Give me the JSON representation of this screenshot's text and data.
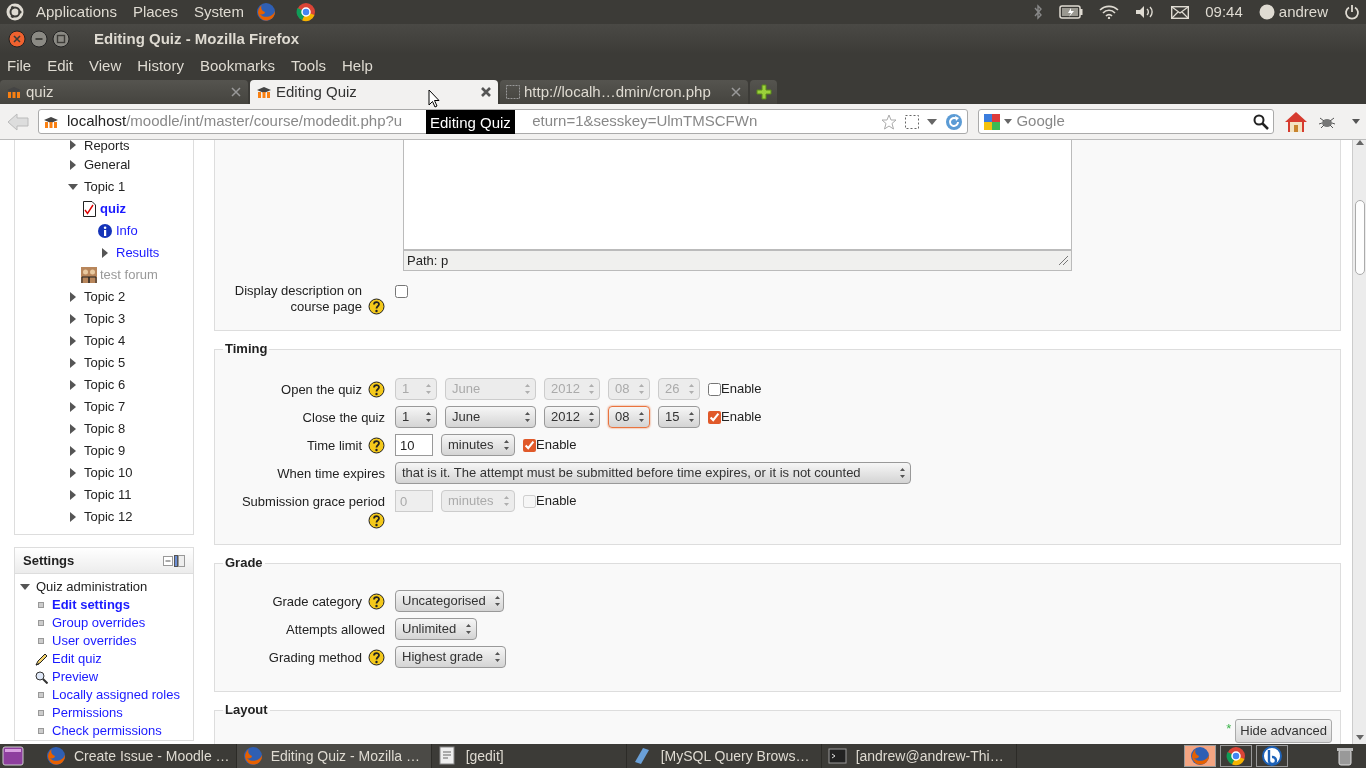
{
  "top_panel": {
    "menus": [
      "Applications",
      "Places",
      "System"
    ],
    "clock": "09:44",
    "user": "andrew"
  },
  "window": {
    "title": "Editing Quiz - Mozilla Firefox"
  },
  "menu_bar": [
    "File",
    "Edit",
    "View",
    "History",
    "Bookmarks",
    "Tools",
    "Help"
  ],
  "tabs": [
    {
      "label": "quiz",
      "kind": "site",
      "selected": false
    },
    {
      "label": "Editing Quiz",
      "kind": "site",
      "selected": true
    },
    {
      "label": "http://localh…dmin/cron.php",
      "kind": "blank",
      "selected": false
    }
  ],
  "address_bar": {
    "host": "localhost",
    "path_start": "/moodle/int/master/course/modedit.php?u",
    "path_end": "eturn=1&sesskey=UlmTMSCFWn"
  },
  "tooltip": "Editing Quiz",
  "search": {
    "placeholder": "Google"
  },
  "navigation": [
    {
      "label": "Reports",
      "kind": "section",
      "expanded": false,
      "selected": false
    },
    {
      "label": "General",
      "kind": "section",
      "expanded": false,
      "selected": false
    },
    {
      "label": "Topic 1",
      "kind": "section",
      "expanded": true,
      "selected": false,
      "children": [
        {
          "label": "quiz",
          "kind": "quiz",
          "selected": true,
          "dimmed": false,
          "children": [
            {
              "label": "Info",
              "kind": "info",
              "selected": false
            },
            {
              "label": "Results",
              "kind": "branch",
              "expanded": false,
              "selected": false
            }
          ]
        },
        {
          "label": "test forum",
          "kind": "forum",
          "selected": false,
          "dimmed": true
        }
      ]
    },
    {
      "label": "Topic 2",
      "kind": "section",
      "expanded": false,
      "selected": false
    },
    {
      "label": "Topic 3",
      "kind": "section",
      "expanded": false,
      "selected": false
    },
    {
      "label": "Topic 4",
      "kind": "section",
      "expanded": false,
      "selected": false
    },
    {
      "label": "Topic 5",
      "kind": "section",
      "expanded": false,
      "selected": false
    },
    {
      "label": "Topic 6",
      "kind": "section",
      "expanded": false,
      "selected": false
    },
    {
      "label": "Topic 7",
      "kind": "section",
      "expanded": false,
      "selected": false
    },
    {
      "label": "Topic 8",
      "kind": "section",
      "expanded": false,
      "selected": false
    },
    {
      "label": "Topic 9",
      "kind": "section",
      "expanded": false,
      "selected": false
    },
    {
      "label": "Topic 10",
      "kind": "section",
      "expanded": false,
      "selected": false
    },
    {
      "label": "Topic 11",
      "kind": "section",
      "expanded": false,
      "selected": false
    },
    {
      "label": "Topic 12",
      "kind": "section",
      "expanded": false,
      "selected": false
    }
  ],
  "settings": {
    "title": "Settings",
    "items": [
      {
        "label": "Quiz administration",
        "kind": "section",
        "expanded": true,
        "selected": false,
        "children": [
          {
            "label": "Edit settings",
            "kind": "leaf",
            "selected": true
          },
          {
            "label": "Group overrides",
            "kind": "leaf",
            "selected": false
          },
          {
            "label": "User overrides",
            "kind": "leaf",
            "selected": false
          },
          {
            "label": "Edit quiz",
            "kind": "edit",
            "selected": false
          },
          {
            "label": "Preview",
            "kind": "preview",
            "selected": false
          },
          {
            "label": "Locally assigned roles",
            "kind": "leaf",
            "selected": false
          },
          {
            "label": "Permissions",
            "kind": "leaf",
            "selected": false
          },
          {
            "label": "Check permissions",
            "kind": "leaf",
            "selected": false
          }
        ]
      }
    ]
  },
  "description": {
    "path": "Path: p",
    "label": "Display description on course page",
    "help": true,
    "checked": false
  },
  "sections": [
    {
      "legend": "Timing",
      "rows": [
        {
          "label": "Open the quiz",
          "help": true,
          "controls": [
            {
              "kind": "select",
              "value": "1",
              "disabled": true,
              "focused": false
            },
            {
              "kind": "select",
              "value": "June",
              "disabled": true,
              "focused": false
            },
            {
              "kind": "select",
              "value": "2012",
              "disabled": true,
              "focused": false
            },
            {
              "kind": "select",
              "value": "08",
              "disabled": true,
              "focused": false
            },
            {
              "kind": "select",
              "value": "26",
              "disabled": true,
              "focused": false
            },
            {
              "kind": "checkbox",
              "label": "Enable",
              "checked": false,
              "disabled": false
            }
          ]
        },
        {
          "label": "Close the quiz",
          "help": false,
          "controls": [
            {
              "kind": "select",
              "value": "1",
              "disabled": false,
              "focused": false
            },
            {
              "kind": "select",
              "value": "June",
              "disabled": false,
              "focused": false
            },
            {
              "kind": "select",
              "value": "2012",
              "disabled": false,
              "focused": false
            },
            {
              "kind": "select",
              "value": "08",
              "disabled": false,
              "focused": true
            },
            {
              "kind": "select",
              "value": "15",
              "disabled": false,
              "focused": false
            },
            {
              "kind": "checkbox",
              "label": "Enable",
              "checked": true,
              "disabled": false
            }
          ]
        },
        {
          "label": "Time limit",
          "help": true,
          "controls": [
            {
              "kind": "input",
              "value": "10",
              "disabled": false
            },
            {
              "kind": "select",
              "value": "minutes",
              "disabled": false,
              "focused": false
            },
            {
              "kind": "checkbox",
              "label": "Enable",
              "checked": true,
              "disabled": false
            }
          ]
        },
        {
          "label": "When time expires",
          "help": false,
          "controls": [
            {
              "kind": "select",
              "value": "that is it. The attempt must be submitted before time expires, or it is not counted",
              "disabled": false,
              "focused": false
            }
          ]
        },
        {
          "label": "Submission grace period",
          "help": true,
          "controls": [
            {
              "kind": "input",
              "value": "0",
              "disabled": true
            },
            {
              "kind": "select",
              "value": "minutes",
              "disabled": true,
              "focused": false
            },
            {
              "kind": "checkbox",
              "label": "Enable",
              "checked": false,
              "disabled": true
            }
          ]
        }
      ]
    },
    {
      "legend": "Grade",
      "rows": [
        {
          "label": "Grade category",
          "help": true,
          "controls": [
            {
              "kind": "select",
              "value": "Uncategorised",
              "disabled": false,
              "focused": false
            }
          ]
        },
        {
          "label": "Attempts allowed",
          "help": false,
          "controls": [
            {
              "kind": "select",
              "value": "Unlimited",
              "disabled": false,
              "focused": false
            }
          ]
        },
        {
          "label": "Grading method",
          "help": true,
          "controls": [
            {
              "kind": "select",
              "value": "Highest grade",
              "disabled": false,
              "focused": false
            }
          ]
        }
      ]
    }
  ],
  "layout": {
    "legend": "Layout",
    "advanced_mark": "*",
    "button": "Hide advanced"
  },
  "taskbar": {
    "windows": [
      {
        "label": "Create Issue - Moodle …",
        "kind": "browser",
        "selected": false
      },
      {
        "label": "Editing Quiz - Mozilla …",
        "kind": "browser",
        "selected": true
      },
      {
        "label": "[gedit]",
        "kind": "editor",
        "selected": false
      },
      {
        "label": "[MySQL Query Brows…",
        "kind": "query",
        "selected": false
      },
      {
        "label": "[andrew@andrew-Thi…",
        "kind": "terminal",
        "selected": false
      }
    ],
    "launchers": [
      {
        "kind": "firefox",
        "selected": true
      },
      {
        "kind": "chrome",
        "selected": false
      },
      {
        "kind": "other",
        "selected": false
      }
    ]
  }
}
